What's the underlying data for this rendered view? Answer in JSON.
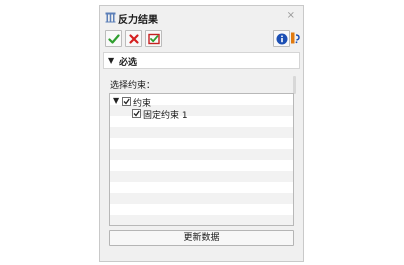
{
  "window": {
    "title": "反力结果",
    "close_glyph": "⨯"
  },
  "toolbar": {
    "ok": {
      "icon": "check-icon",
      "color": "#2e9e2e"
    },
    "cancel": {
      "icon": "x-icon",
      "color": "#d42020"
    },
    "apply": {
      "icon": "apply-check-icon",
      "color": "#c42020"
    },
    "info": {
      "icon": "info-icon",
      "color": "#1c4fb4"
    },
    "help": {
      "icon": "help-icon",
      "color": "#e07a10"
    }
  },
  "section": {
    "label": "必选",
    "arrow": "▼"
  },
  "constraints": {
    "label": "选择约束：",
    "tree": [
      {
        "label": "约束",
        "checked": true,
        "expander": "▼"
      },
      {
        "label": "固定约束 1",
        "checked": true
      }
    ]
  },
  "update_button": {
    "label": "更新数据"
  }
}
